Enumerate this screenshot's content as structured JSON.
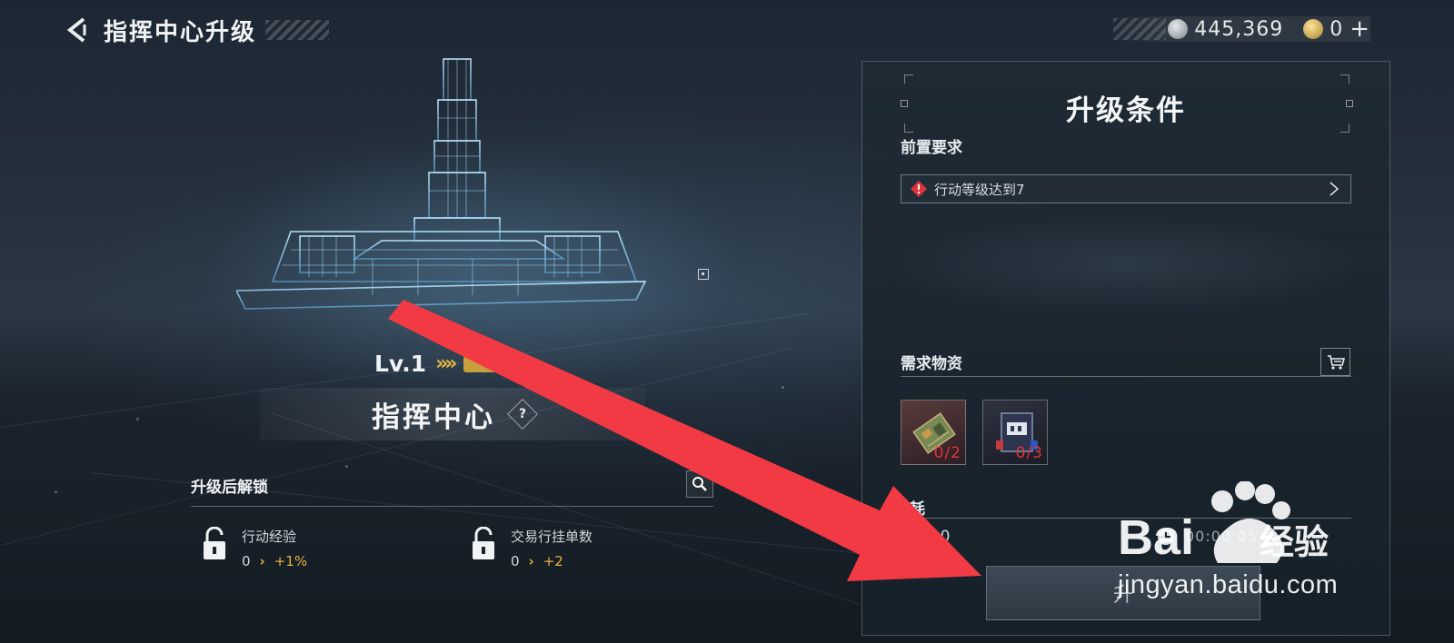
{
  "header": {
    "title": "指挥中心升级"
  },
  "currency": {
    "silver": "445,369",
    "gold": "0"
  },
  "building": {
    "level": "Lv.1",
    "name": "指挥中心"
  },
  "unlock": {
    "title": "升级后解锁",
    "items": [
      {
        "name": "行动经验",
        "current": "0",
        "gain": "+1%"
      },
      {
        "name": "交易行挂单数",
        "current": "0",
        "gain": "+2"
      }
    ]
  },
  "panel": {
    "title": "升级条件",
    "prereq_label": "前置要求",
    "prereq_text": "行动等级达到7",
    "materials_label": "需求物资",
    "materials": [
      {
        "icon": "circuit-board-icon",
        "count": "0/2"
      },
      {
        "icon": "electronic-device-icon",
        "count": "0/3"
      }
    ],
    "cost_label": "耗",
    "cost_value": "000",
    "time_value": "00:00:05",
    "upgrade_label": "升"
  },
  "watermark": {
    "text": "jingyan.baidu.com",
    "brand": "Baidu经验"
  },
  "colors": {
    "accent_gold": "#e8b23c",
    "warning_red": "#e0353a",
    "annotation_red": "#f23a44"
  }
}
